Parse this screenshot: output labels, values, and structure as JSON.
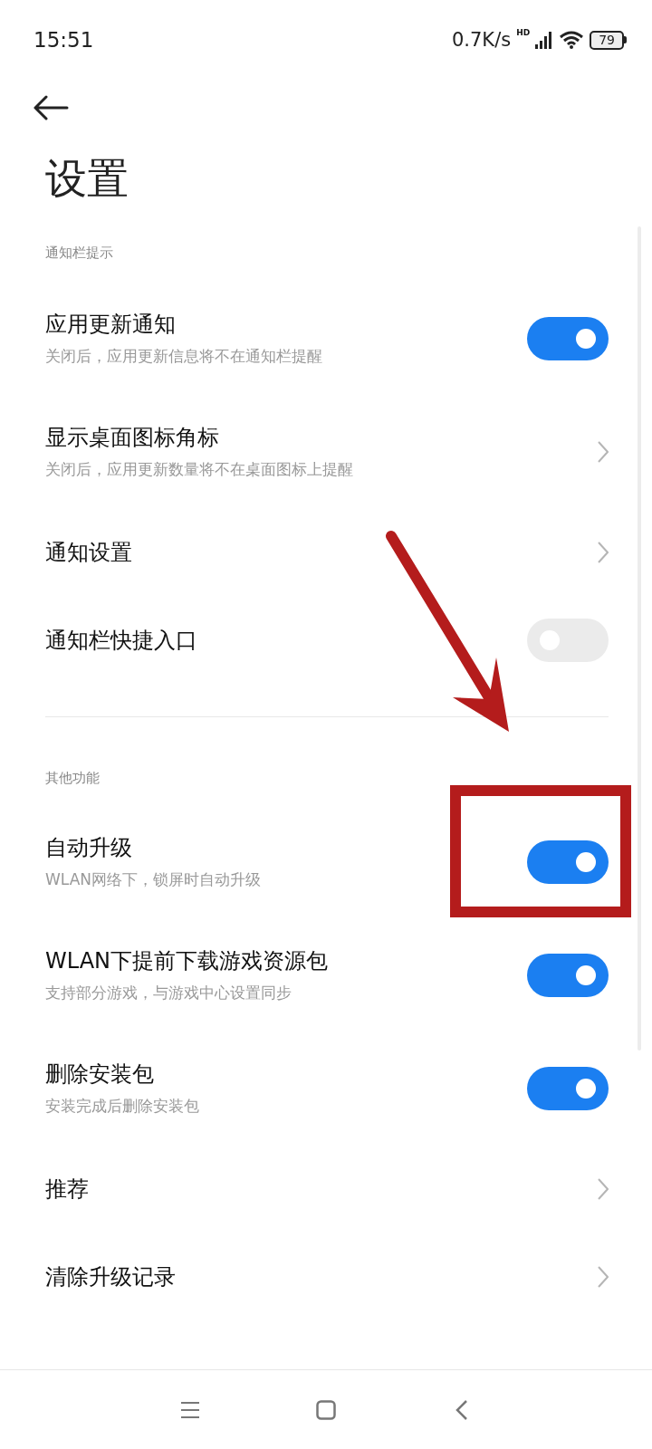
{
  "status_bar": {
    "time": "15:51",
    "speed": "0.7K/s",
    "network": "HD",
    "battery": "79"
  },
  "title": "设置",
  "sections": [
    {
      "label": "通知栏提示",
      "items": [
        {
          "kind": "toggle",
          "title": "应用更新通知",
          "subtitle": "关闭后，应用更新信息将不在通知栏提醒",
          "on": true
        },
        {
          "kind": "link",
          "title": "显示桌面图标角标",
          "subtitle": "关闭后，应用更新数量将不在桌面图标上提醒"
        },
        {
          "kind": "link",
          "title": "通知设置"
        },
        {
          "kind": "toggle",
          "title": "通知栏快捷入口",
          "on": false
        }
      ]
    },
    {
      "label": "其他功能",
      "items": [
        {
          "kind": "toggle",
          "title": "自动升级",
          "subtitle": "WLAN网络下，锁屏时自动升级",
          "on": true
        },
        {
          "kind": "toggle",
          "title": "WLAN下提前下载游戏资源包",
          "subtitle": "支持部分游戏，与游戏中心设置同步",
          "on": true
        },
        {
          "kind": "toggle",
          "title": "删除安装包",
          "subtitle": "安装完成后删除安装包",
          "on": true
        },
        {
          "kind": "link",
          "title": "推荐"
        },
        {
          "kind": "link",
          "title": "清除升级记录"
        }
      ]
    }
  ]
}
